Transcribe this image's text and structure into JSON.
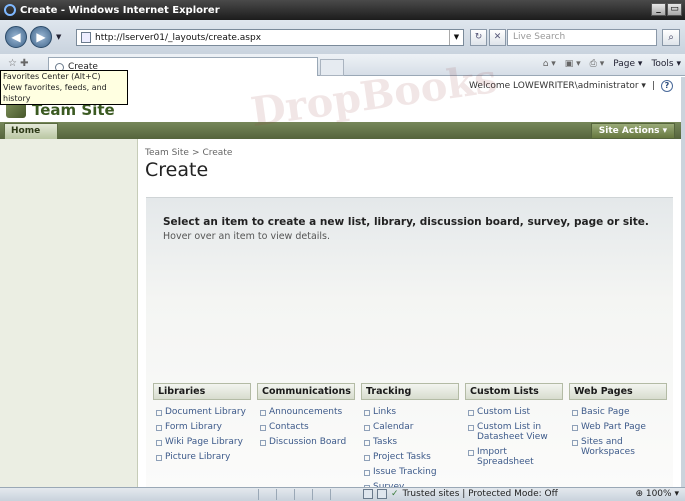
{
  "window": {
    "title": "Create - Windows Internet Explorer",
    "min": "_",
    "restore": "▭"
  },
  "address": {
    "url": "http://lserver01/_layouts/create.aspx"
  },
  "search": {
    "placeholder": "Live Search"
  },
  "tab": {
    "label": "Create"
  },
  "commands": {
    "page": "Page ▾",
    "tools": "Tools ▾"
  },
  "tooltip": {
    "line1": "Favorites Center (Alt+C)",
    "line2": "View favorites, feeds, and history"
  },
  "watermark": "DropBooks",
  "welcome": {
    "text": "Welcome LOWEWRITER\\administrator ▾",
    "sep": "|"
  },
  "site": {
    "title": "Team Site"
  },
  "nav": {
    "home": "Home",
    "site_actions": "Site Actions ▾"
  },
  "breadcrumb": {
    "root": "Team Site",
    "sep": ">",
    "current": "Create"
  },
  "page": {
    "title": "Create",
    "heading": "Select an item to create a new list, library, discussion board, survey, page or site.",
    "sub": "Hover over an item to view details."
  },
  "categories": [
    {
      "header": "Libraries",
      "items": [
        "Document Library",
        "Form Library",
        "Wiki Page Library",
        "Picture Library"
      ]
    },
    {
      "header": "Communications",
      "items": [
        "Announcements",
        "Contacts",
        "Discussion Board"
      ]
    },
    {
      "header": "Tracking",
      "items": [
        "Links",
        "Calendar",
        "Tasks",
        "Project Tasks",
        "Issue Tracking",
        "Survey"
      ]
    },
    {
      "header": "Custom Lists",
      "items": [
        "Custom List",
        "Custom List in Datasheet View",
        "Import Spreadsheet"
      ]
    },
    {
      "header": "Web Pages",
      "items": [
        "Basic Page",
        "Web Part Page",
        "Sites and Workspaces"
      ]
    }
  ],
  "status": {
    "zone": "Trusted sites | Protected Mode: Off",
    "zoom": "100%"
  }
}
